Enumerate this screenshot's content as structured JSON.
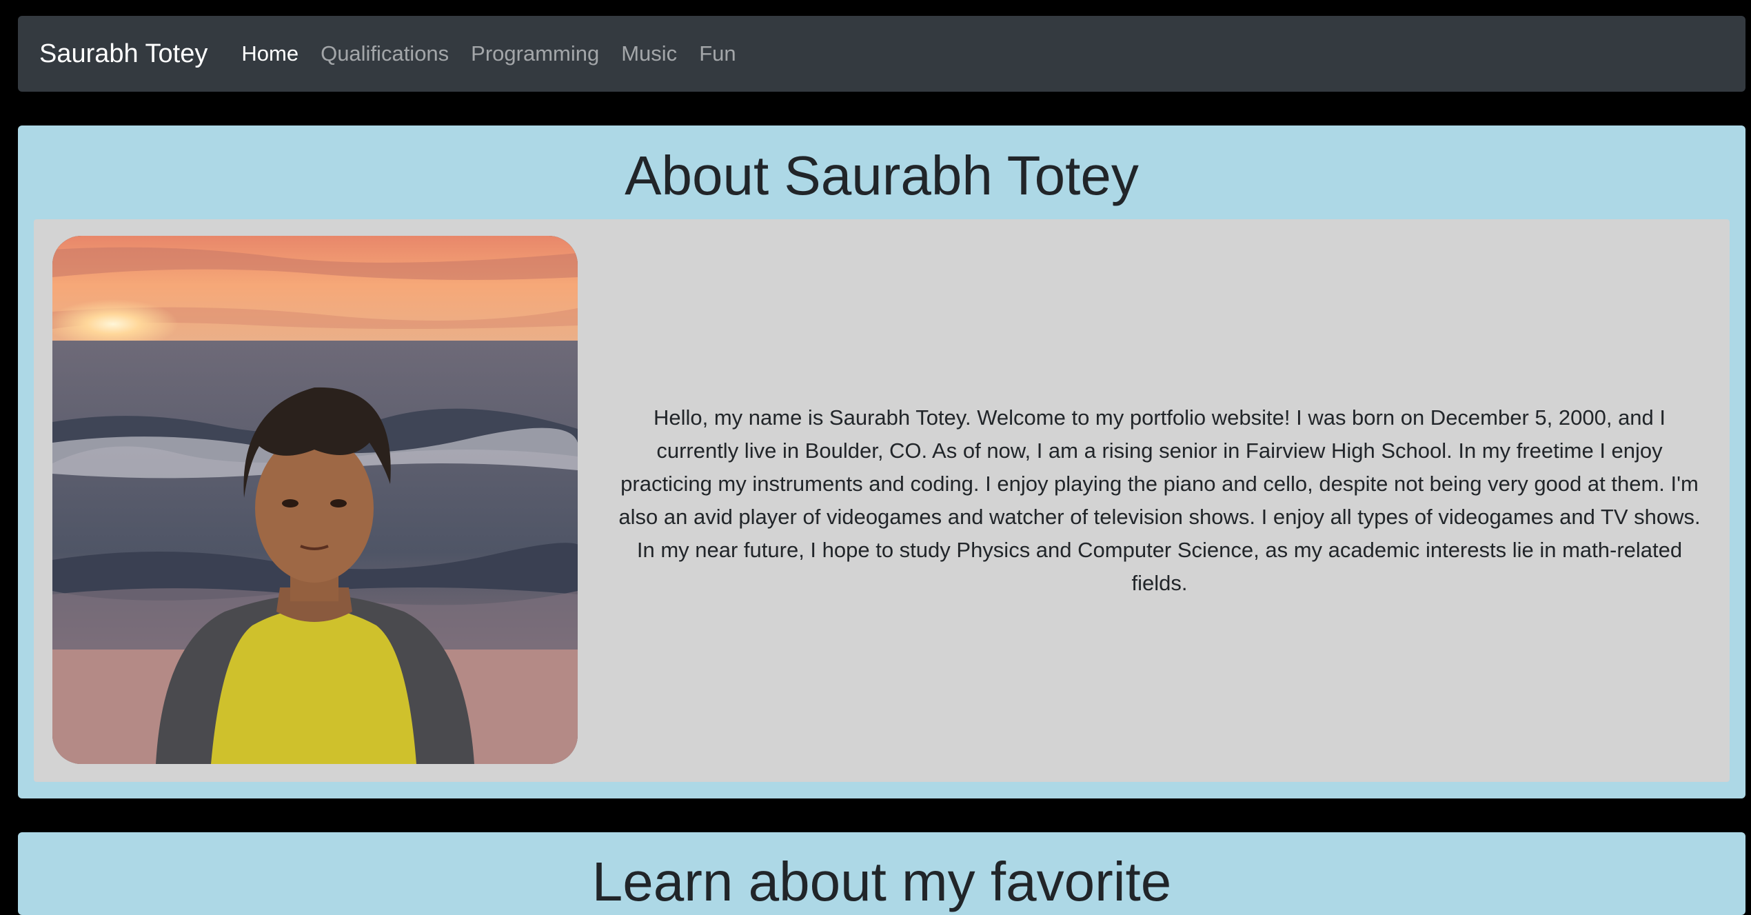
{
  "navbar": {
    "brand": "Saurabh Totey",
    "links": [
      {
        "label": "Home",
        "active": true
      },
      {
        "label": "Qualifications",
        "active": false
      },
      {
        "label": "Programming",
        "active": false
      },
      {
        "label": "Music",
        "active": false
      },
      {
        "label": "Fun",
        "active": false
      }
    ]
  },
  "about": {
    "title": "About Saurabh Totey",
    "bio": "Hello, my name is Saurabh Totey. Welcome to my portfolio website! I was born on December 5, 2000, and I currently live in Boulder, CO. As of now, I am a rising senior in Fairview High School. In my freetime I enjoy practicing my instruments and coding. I enjoy playing the piano and cello, despite not being very good at them. I'm also an avid player of videogames and watcher of television shows. I enjoy all types of videogames and TV shows. In my near future, I hope to study Physics and Computer Science, as my academic interests lie in math-related fields."
  },
  "next_section": {
    "title": "Learn about my favorite"
  },
  "colors": {
    "page_background": "#000000",
    "navbar_background": "#343a40",
    "section_background": "#add8e6",
    "panel_background": "#d3d3d3",
    "heading_text": "#212529"
  }
}
